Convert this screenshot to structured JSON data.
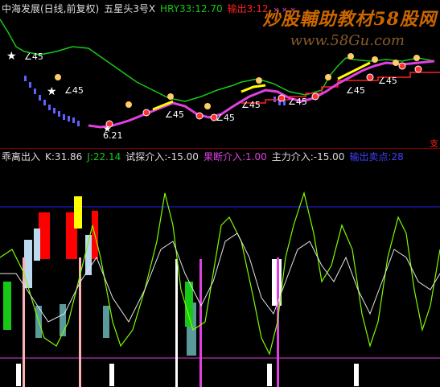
{
  "top_header": {
    "stock": "中海发展(日线,前复权)",
    "formula": "五星头3号X",
    "hry_label": "HRY33:12.70",
    "output_label": "输出3:12",
    "markers": "× × ×"
  },
  "watermark": {
    "title": "炒股輔助教材58股网",
    "url": "www.58Gu.com"
  },
  "top_annotations": {
    "angle": "∠45",
    "low_price": "6.21",
    "edge_mark": "支"
  },
  "bottom_header": {
    "name": "乖离出入",
    "k": "K:31.86",
    "j": "J:22.14",
    "trial": "试探介入:-15.00",
    "decisive": "果断介入:1.00",
    "main": "主力介入:-15.00",
    "output": "输出卖点:28"
  },
  "colors": {
    "red": "#ff2020",
    "green": "#18c818",
    "yellow": "#ffff00",
    "magenta": "#e040e0",
    "blue": "#2020ff",
    "lightgreen": "#7cfc00",
    "white": "#ffffff"
  }
}
